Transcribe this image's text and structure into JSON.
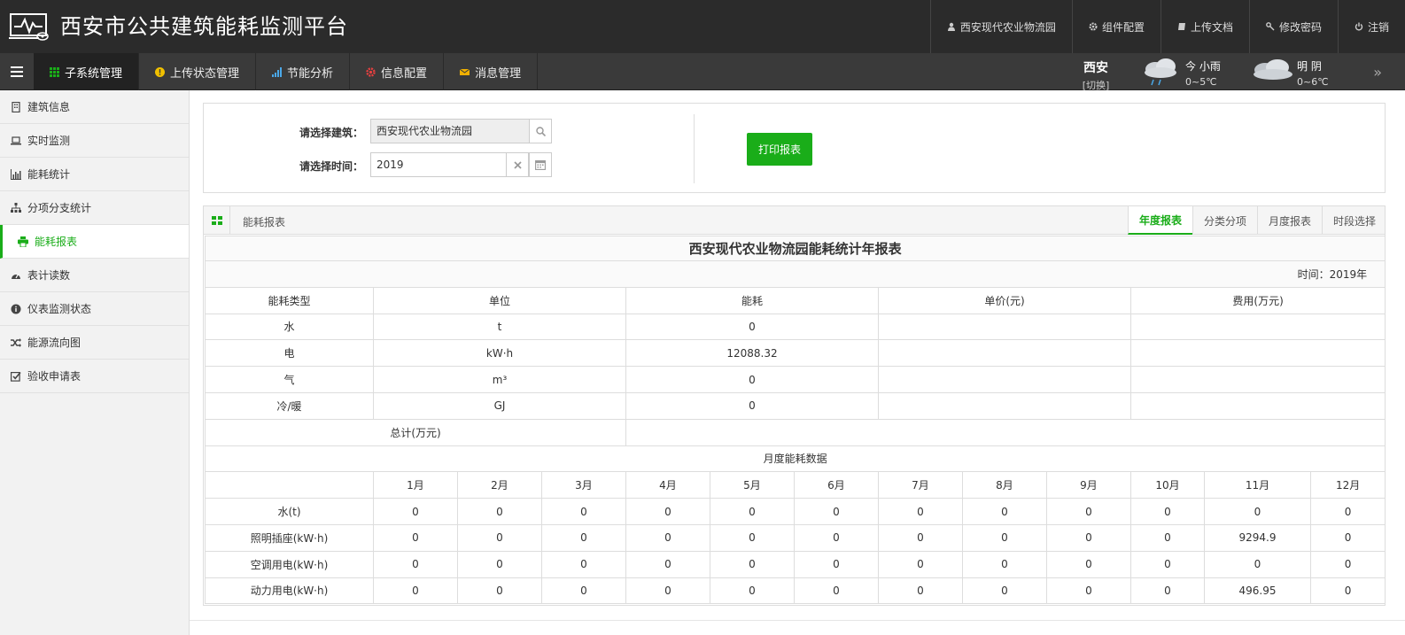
{
  "app": {
    "title": "西安市公共建筑能耗监测平台"
  },
  "top_actions": [
    {
      "label": "西安现代农业物流园",
      "icon": "user-icon"
    },
    {
      "label": "组件配置",
      "icon": "gear-icon"
    },
    {
      "label": "上传文档",
      "icon": "book-icon"
    },
    {
      "label": "修改密码",
      "icon": "key-icon"
    },
    {
      "label": "注销",
      "icon": "power-icon"
    }
  ],
  "nav": {
    "tabs": [
      {
        "label": "子系统管理",
        "icon": "grid-icon",
        "color": "#1aad19"
      },
      {
        "label": "上传状态管理",
        "icon": "info-icon",
        "color": "#f0c000"
      },
      {
        "label": "节能分析",
        "icon": "bar-chart-icon",
        "color": "#4aa8e8"
      },
      {
        "label": "信息配置",
        "icon": "gear-icon",
        "color": "#e84040"
      },
      {
        "label": "消息管理",
        "icon": "envelope-icon",
        "color": "#f0b000"
      }
    ],
    "active_index": 0
  },
  "weather": {
    "city": "西安",
    "switch_label": "[切换]",
    "days": [
      {
        "label": "今 小雨",
        "temp": "0~5℃",
        "icon": "rain-cloud-icon"
      },
      {
        "label": "明 阴",
        "temp": "0~6℃",
        "icon": "overcast-cloud-icon"
      }
    ],
    "more": "»"
  },
  "sidebar": {
    "items": [
      {
        "label": "建筑信息",
        "icon": "building-icon"
      },
      {
        "label": "实时监测",
        "icon": "laptop-icon"
      },
      {
        "label": "能耗统计",
        "icon": "bar-chart-icon"
      },
      {
        "label": "分项分支统计",
        "icon": "sitemap-icon"
      },
      {
        "label": "能耗报表",
        "icon": "print-icon"
      },
      {
        "label": "表计读数",
        "icon": "gauge-icon"
      },
      {
        "label": "仪表监测状态",
        "icon": "info-circle-icon"
      },
      {
        "label": "能源流向图",
        "icon": "shuffle-icon"
      },
      {
        "label": "验收申请表",
        "icon": "checkbox-icon"
      }
    ],
    "active_index": 4
  },
  "filter": {
    "building_label": "请选择建筑：",
    "building_value": "西安现代农业物流园",
    "time_label": "请选择时间：",
    "time_value": "2019",
    "print_button": "打印报表"
  },
  "report": {
    "panel_title": "能耗报表",
    "tabs": [
      "年度报表",
      "分类分项",
      "月度报表",
      "时段选择"
    ],
    "active_tab": 0,
    "title": "西安现代农业物流园能耗统计年报表",
    "time_text": "时间：2019年",
    "summary_headers": [
      "能耗类型",
      "单位",
      "能耗",
      "单价(元)",
      "费用(万元)"
    ],
    "summary_rows": [
      [
        "水",
        "t",
        "0",
        "",
        ""
      ],
      [
        "电",
        "kW·h",
        "12088.32",
        "",
        ""
      ],
      [
        "气",
        "m³",
        "0",
        "",
        ""
      ],
      [
        "冷/暖",
        "GJ",
        "0",
        "",
        ""
      ]
    ],
    "total_label": "总计(万元)",
    "total_value": "",
    "monthly_title": "月度能耗数据",
    "month_headers": [
      "",
      "1月",
      "2月",
      "3月",
      "4月",
      "5月",
      "6月",
      "7月",
      "8月",
      "9月",
      "10月",
      "11月",
      "12月"
    ],
    "monthly_rows": [
      [
        "水(t)",
        "0",
        "0",
        "0",
        "0",
        "0",
        "0",
        "0",
        "0",
        "0",
        "0",
        "0",
        "0"
      ],
      [
        "照明插座(kW·h)",
        "0",
        "0",
        "0",
        "0",
        "0",
        "0",
        "0",
        "0",
        "0",
        "0",
        "9294.9",
        "0"
      ],
      [
        "空调用电(kW·h)",
        "0",
        "0",
        "0",
        "0",
        "0",
        "0",
        "0",
        "0",
        "0",
        "0",
        "0",
        "0"
      ],
      [
        "动力用电(kW·h)",
        "0",
        "0",
        "0",
        "0",
        "0",
        "0",
        "0",
        "0",
        "0",
        "0",
        "496.95",
        "0"
      ]
    ]
  },
  "colors": {
    "accent": "#1aad19",
    "topbar": "#2b2b2b",
    "navbar": "#3a3a3a"
  }
}
